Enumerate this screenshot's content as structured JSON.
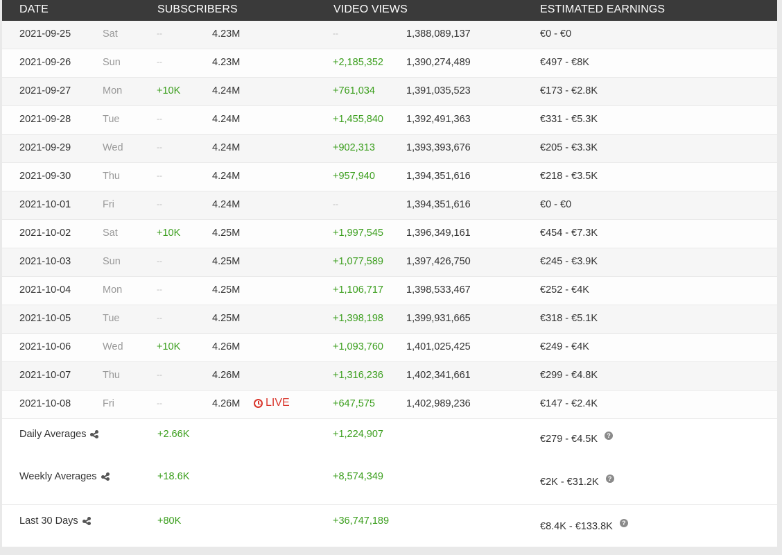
{
  "header": {
    "date": "DATE",
    "subscribers": "SUBSCRIBERS",
    "video_views": "VIDEO VIEWS",
    "estimated_earnings": "ESTIMATED EARNINGS"
  },
  "rows": [
    {
      "date": "2021-09-25",
      "day": "Sat",
      "sub_delta": "--",
      "sub_total": "4.23M",
      "views_delta": "--",
      "views_total": "1,388,089,137",
      "earnings": "€0  -  €0"
    },
    {
      "date": "2021-09-26",
      "day": "Sun",
      "sub_delta": "--",
      "sub_total": "4.23M",
      "views_delta": "+2,185,352",
      "views_total": "1,390,274,489",
      "earnings": "€497  -  €8K"
    },
    {
      "date": "2021-09-27",
      "day": "Mon",
      "sub_delta": "+10K",
      "sub_total": "4.24M",
      "views_delta": "+761,034",
      "views_total": "1,391,035,523",
      "earnings": "€173  -  €2.8K"
    },
    {
      "date": "2021-09-28",
      "day": "Tue",
      "sub_delta": "--",
      "sub_total": "4.24M",
      "views_delta": "+1,455,840",
      "views_total": "1,392,491,363",
      "earnings": "€331  -  €5.3K"
    },
    {
      "date": "2021-09-29",
      "day": "Wed",
      "sub_delta": "--",
      "sub_total": "4.24M",
      "views_delta": "+902,313",
      "views_total": "1,393,393,676",
      "earnings": "€205  -  €3.3K"
    },
    {
      "date": "2021-09-30",
      "day": "Thu",
      "sub_delta": "--",
      "sub_total": "4.24M",
      "views_delta": "+957,940",
      "views_total": "1,394,351,616",
      "earnings": "€218  -  €3.5K"
    },
    {
      "date": "2021-10-01",
      "day": "Fri",
      "sub_delta": "--",
      "sub_total": "4.24M",
      "views_delta": "--",
      "views_total": "1,394,351,616",
      "earnings": "€0  -  €0"
    },
    {
      "date": "2021-10-02",
      "day": "Sat",
      "sub_delta": "+10K",
      "sub_total": "4.25M",
      "views_delta": "+1,997,545",
      "views_total": "1,396,349,161",
      "earnings": "€454  -  €7.3K"
    },
    {
      "date": "2021-10-03",
      "day": "Sun",
      "sub_delta": "--",
      "sub_total": "4.25M",
      "views_delta": "+1,077,589",
      "views_total": "1,397,426,750",
      "earnings": "€245  -  €3.9K"
    },
    {
      "date": "2021-10-04",
      "day": "Mon",
      "sub_delta": "--",
      "sub_total": "4.25M",
      "views_delta": "+1,106,717",
      "views_total": "1,398,533,467",
      "earnings": "€252  -  €4K"
    },
    {
      "date": "2021-10-05",
      "day": "Tue",
      "sub_delta": "--",
      "sub_total": "4.25M",
      "views_delta": "+1,398,198",
      "views_total": "1,399,931,665",
      "earnings": "€318  -  €5.1K"
    },
    {
      "date": "2021-10-06",
      "day": "Wed",
      "sub_delta": "+10K",
      "sub_total": "4.26M",
      "views_delta": "+1,093,760",
      "views_total": "1,401,025,425",
      "earnings": "€249  -  €4K"
    },
    {
      "date": "2021-10-07",
      "day": "Thu",
      "sub_delta": "--",
      "sub_total": "4.26M",
      "views_delta": "+1,316,236",
      "views_total": "1,402,341,661",
      "earnings": "€299  -  €4.8K"
    },
    {
      "date": "2021-10-08",
      "day": "Fri",
      "sub_delta": "--",
      "sub_total": "4.26M",
      "live": "LIVE",
      "views_delta": "+647,575",
      "views_total": "1,402,989,236",
      "earnings": "€147  -  €2.4K"
    }
  ],
  "summary": [
    {
      "label": "Daily Averages",
      "subs": "+2.66K",
      "views": "+1,224,907",
      "earnings": "€279  -  €4.5K"
    },
    {
      "label": "Weekly Averages",
      "subs": "+18.6K",
      "views": "+8,574,349",
      "earnings": "€2K  -  €31.2K"
    },
    {
      "label": "Last 30 Days",
      "subs": "+80K",
      "views": "+36,747,189",
      "earnings": "€8.4K  -  €133.8K"
    }
  ],
  "icons": {
    "share": "share-icon",
    "help": "help-icon",
    "live": "clock-icon"
  },
  "colors": {
    "header_bg": "#3a3a3a",
    "positive": "#3a9e1c",
    "live": "#d9352b"
  }
}
